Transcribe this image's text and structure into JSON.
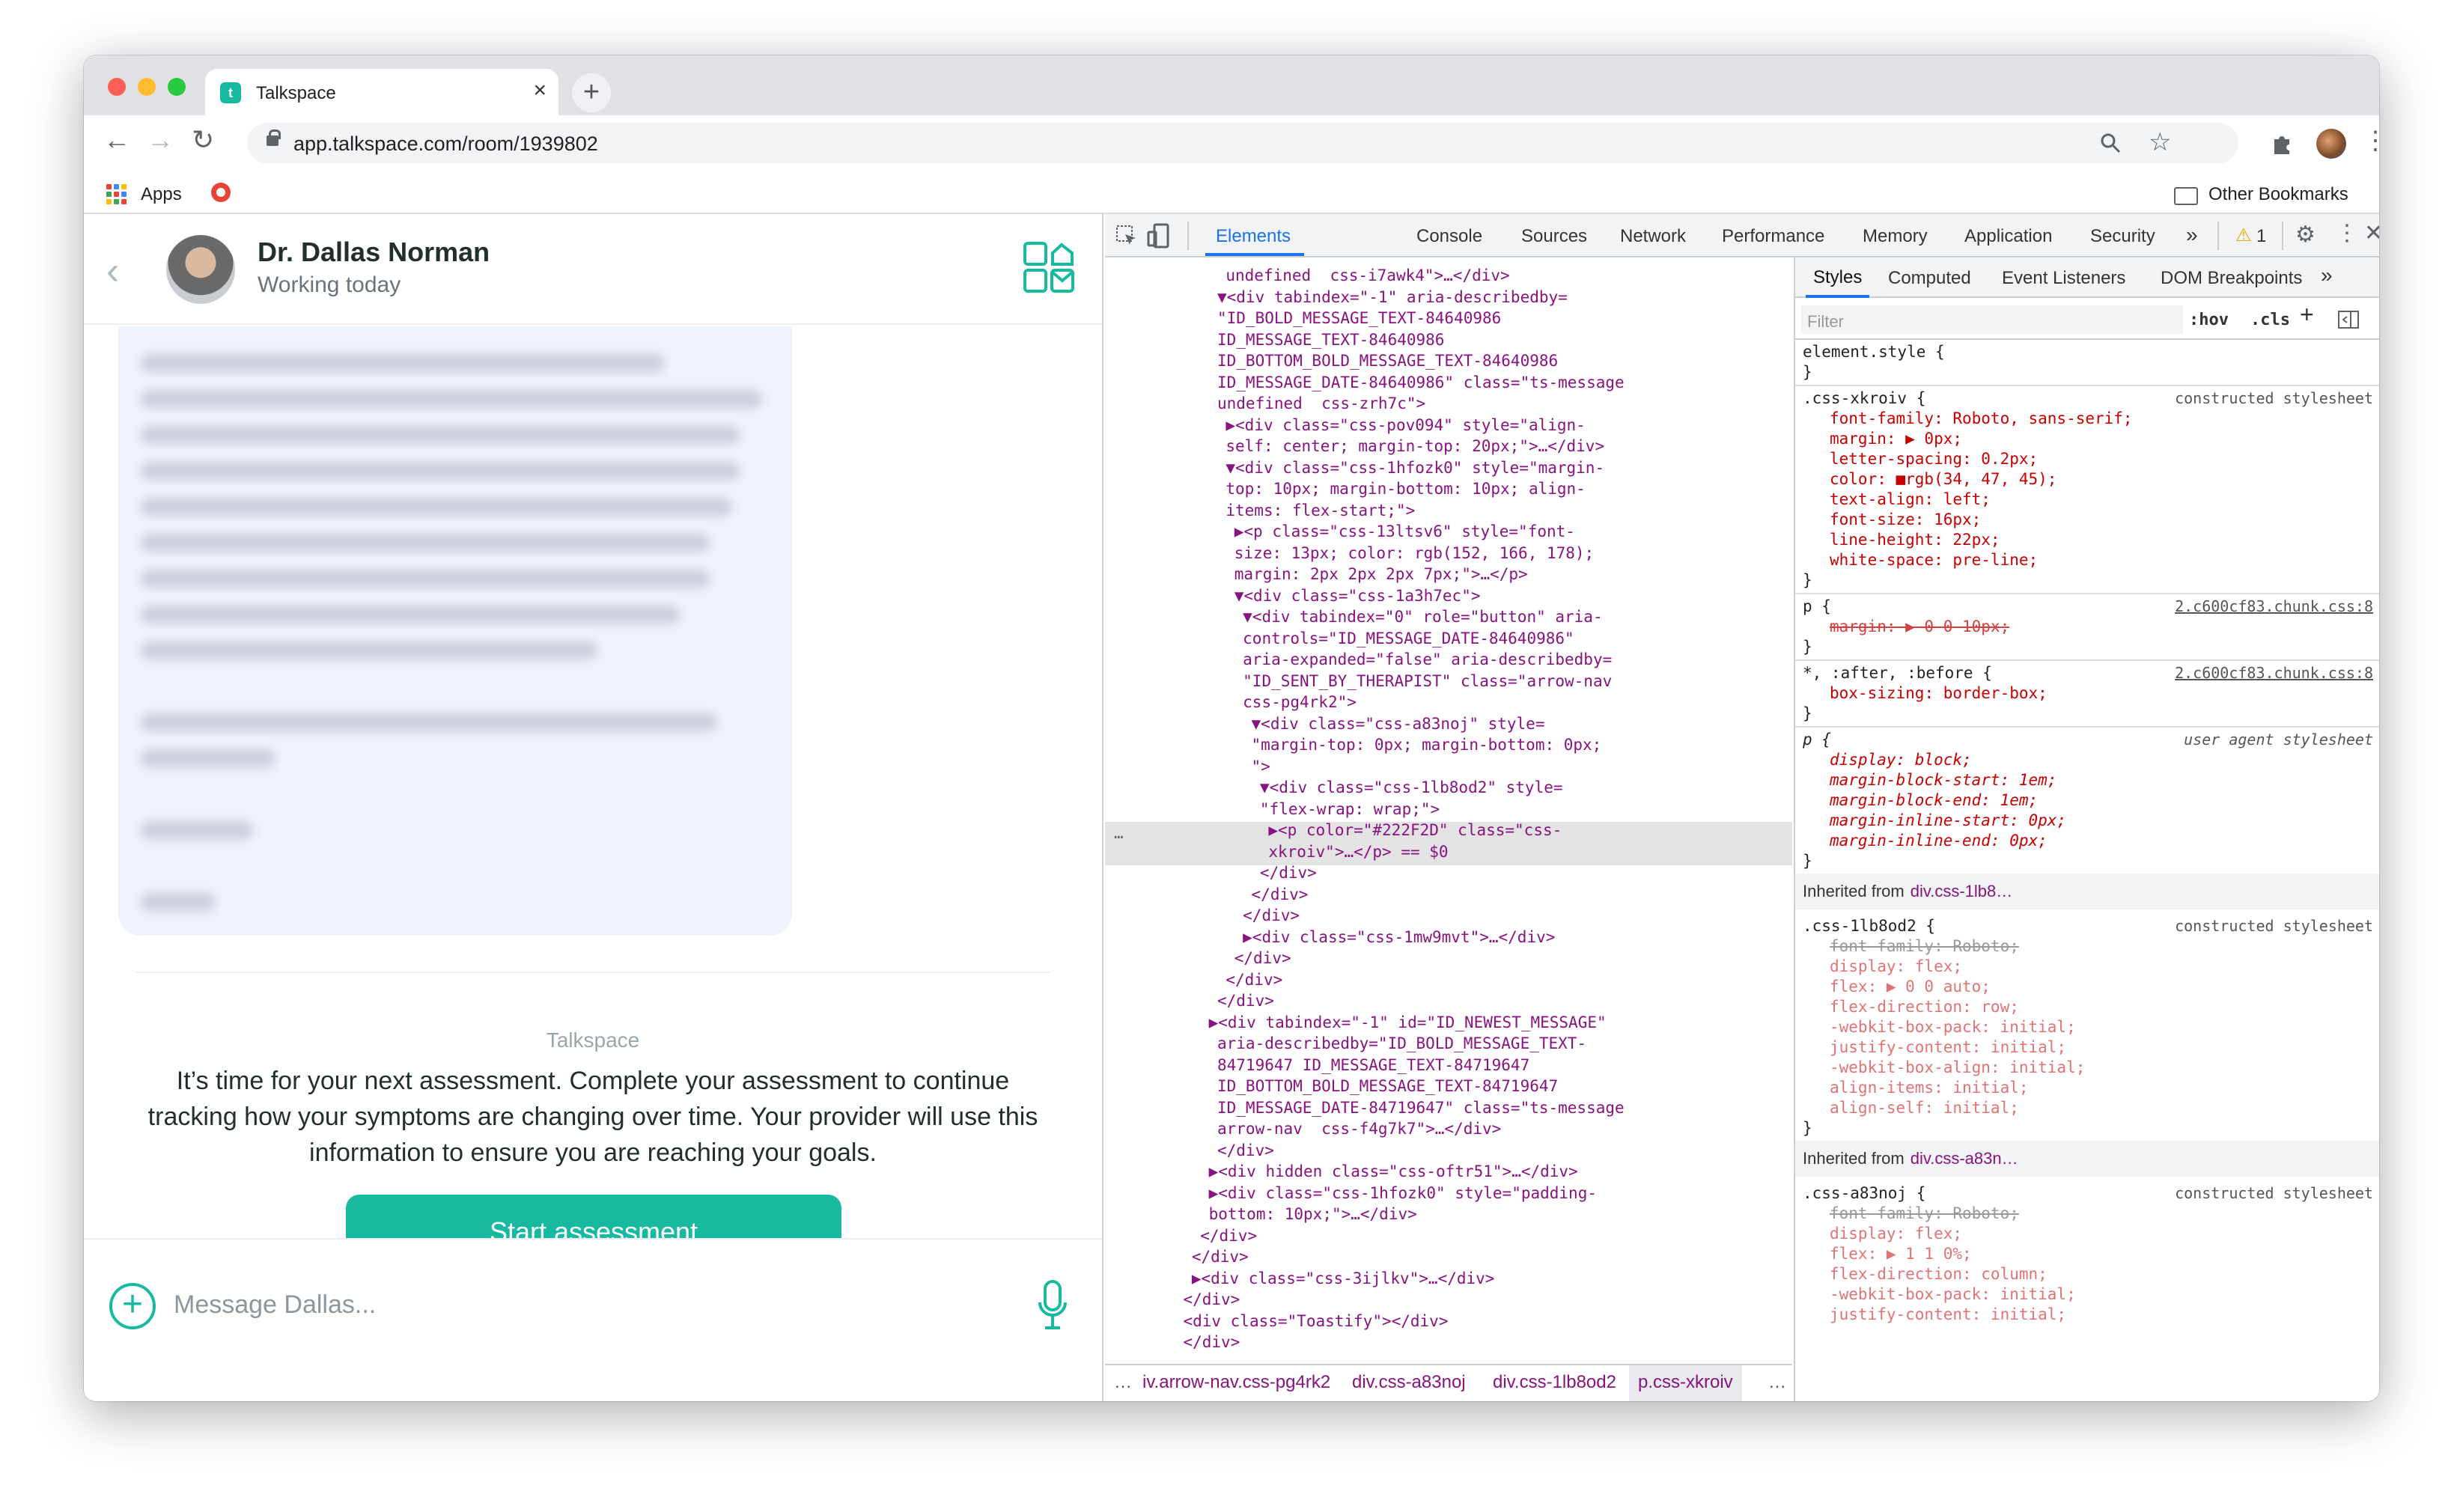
{
  "browser": {
    "tab_title": "Talkspace",
    "tab_favicon": "talkspace-favicon",
    "url": "app.talkspace.com/room/1939802",
    "bookmarks": {
      "apps_label": "Apps",
      "other_label": "Other Bookmarks"
    }
  },
  "app": {
    "therapist_name": "Dr. Dallas Norman",
    "therapist_status": "Working today",
    "system_sender": "Talkspace",
    "system_message": "It’s time for your next assessment. Complete your assessment to continue tracking how your symptoms are changing over time. Your provider will use this information to ensure you are reaching your goals.",
    "start_button": "Start assessment",
    "composer_placeholder": "Message Dallas...",
    "accent_color": "#17b9a0"
  },
  "devtools": {
    "tabs": [
      "Elements",
      "Console",
      "Sources",
      "Network",
      "Performance",
      "Memory",
      "Application",
      "Security"
    ],
    "more_tabs": "»",
    "warning_count": "1",
    "elements_lines": [
      "undefined  css-i7awk4\">…</div>",
      "▼<div tabindex=\"-1\" aria-describedby=",
      "\"ID_BOLD_MESSAGE_TEXT-84640986",
      "ID_MESSAGE_TEXT-84640986",
      "ID_BOTTOM_BOLD_MESSAGE_TEXT-84640986",
      "ID_MESSAGE_DATE-84640986\" class=\"ts-message",
      "undefined  css-zrh7c\">",
      "▶<div class=\"css-pov094\" style=\"align-",
      "self: center; margin-top: 20px;\">…</div>",
      "▼<div class=\"css-1hfozk0\" style=\"margin-",
      "top: 10px; margin-bottom: 10px; align-",
      "items: flex-start;\">",
      "▶<p class=\"css-13ltsv6\" style=\"font-",
      "size: 13px; color: rgb(152, 166, 178);",
      "margin: 2px 2px 2px 7px;\">…</p>",
      "▼<div class=\"css-1a3h7ec\">",
      "▼<div tabindex=\"0\" role=\"button\" aria-",
      "controls=\"ID_MESSAGE_DATE-84640986\"",
      "aria-expanded=\"false\" aria-describedby=",
      "\"ID_SENT_BY_THERAPIST\" class=\"arrow-nav",
      "css-pg4rk2\">",
      "▼<div class=\"css-a83noj\" style=",
      "\"margin-top: 0px; margin-bottom: 0px;",
      "\">",
      "▼<div class=\"css-1lb8od2\" style=",
      "\"flex-wrap: wrap;\">",
      "▶<p color=\"#222F2D\" class=\"css-",
      "xkroiv\">…</p> == $0",
      "</div>",
      "</div>",
      "</div>",
      "▶<div class=\"css-1mw9mvt\">…</div>",
      "</div>",
      "</div>",
      "</div>",
      "▶<div tabindex=\"-1\" id=\"ID_NEWEST_MESSAGE\"",
      "aria-describedby=\"ID_BOLD_MESSAGE_TEXT-",
      "84719647 ID_MESSAGE_TEXT-84719647",
      "ID_BOTTOM_BOLD_MESSAGE_TEXT-84719647",
      "ID_MESSAGE_DATE-84719647\" class=\"ts-message",
      "arrow-nav  css-f4g7k7\">…</div>",
      "</div>",
      "▶<div hidden class=\"css-oftr51\">…</div>",
      "▶<div class=\"css-1hfozk0\" style=\"padding-",
      "bottom: 10px;\">…</div>",
      "</div>",
      "</div>",
      "▶<div class=\"css-3ijlkv\">…</div>",
      "</div>",
      "<div class=\"Toastify\"></div>",
      "</div>"
    ],
    "breadcrumbs": [
      "…",
      "iv.arrow-nav.css-pg4rk2",
      "div.css-a83noj",
      "div.css-1lb8od2",
      "p.css-xkroiv",
      "…"
    ],
    "styles_tabs": [
      "Styles",
      "Computed",
      "Event Listeners",
      "DOM Breakpoints",
      "»"
    ],
    "filter_placeholder": "Filter",
    "filter_hov": ":hov",
    "filter_cls": ".cls",
    "element_style": "element.style {",
    "rule1_selector": ".css-xkroiv {",
    "rule1_source": "constructed stylesheet",
    "rule1_props": [
      "font-family: Roboto, sans-serif;",
      "margin: ▶ 0px;",
      "letter-spacing: 0.2px;",
      "color: ■rgb(34, 47, 45);",
      "text-align: left;",
      "font-size: 16px;",
      "line-height: 22px;",
      "white-space: pre-line;"
    ],
    "rule2_selector": "p {",
    "rule2_source": "2.c600cf83.chunk.css:8",
    "rule2_prop": "margin: ▶ 0 0 10px;",
    "rule3_selector": "*, :after, :before {",
    "rule3_source": "2.c600cf83.chunk.css:8",
    "rule3_prop": "box-sizing: border-box;",
    "rule4_selector": "p {",
    "rule4_source": "user agent stylesheet",
    "rule4_props": [
      "display: block;",
      "margin-block-start: 1em;",
      "margin-block-end: 1em;",
      "margin-inline-start: 0px;",
      "margin-inline-end: 0px;"
    ],
    "inherited1": "Inherited from",
    "inherited1_target": "div.css-1lb8…",
    "rule5_selector": ".css-1lb8od2 {",
    "rule5_source": "constructed stylesheet",
    "rule5_props": [
      "font-family: Roboto;",
      "display: flex;",
      "flex: ▶ 0 0 auto;",
      "flex-direction: row;",
      "-webkit-box-pack: initial;",
      "justify-content: initial;",
      "-webkit-box-align: initial;",
      "align-items: initial;",
      "align-self: initial;"
    ],
    "inherited2": "Inherited from",
    "inherited2_target": "div.css-a83n…",
    "rule6_selector": ".css-a83noj {",
    "rule6_source": "constructed stylesheet",
    "rule6_props": [
      "font-family: Roboto;",
      "display: flex;",
      "flex: ▶ 1 1 0%;",
      "flex-direction: column;",
      "-webkit-box-pack: initial;",
      "justify-content: initial;"
    ],
    "close_brace": "}"
  }
}
